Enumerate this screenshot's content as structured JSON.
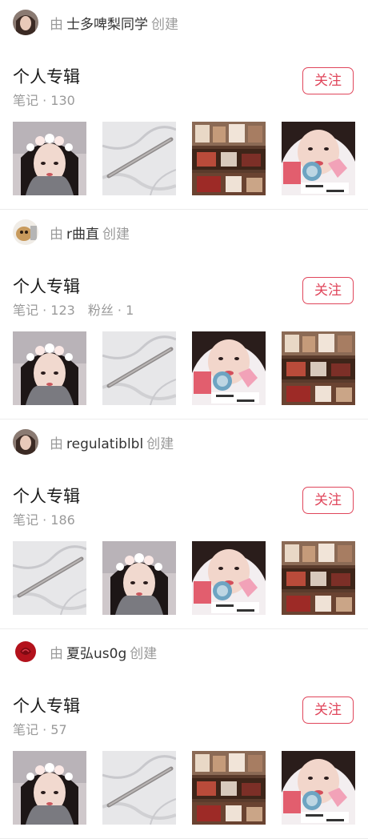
{
  "albums": [
    {
      "creator_prefix": "由",
      "creator_name": "士多啤梨同学",
      "creator_suffix": "创建",
      "avatar": "avatar-photo-girl",
      "title": "个人专辑",
      "notes_label": "笔记 · 130",
      "fans_label": "",
      "follow_label": "关注",
      "thumbnails": [
        "selfie-flower-crown",
        "eyebrow-pencil-marble",
        "cosmetics-shelf",
        "selfie-lip-tint"
      ]
    },
    {
      "creator_prefix": "由",
      "creator_name": "r曲直",
      "creator_suffix": "创建",
      "avatar": "avatar-photo-dog",
      "title": "个人专辑",
      "notes_label": "笔记 · 123",
      "fans_label": "粉丝 · 1",
      "follow_label": "关注",
      "thumbnails": [
        "selfie-flower-crown",
        "eyebrow-pencil-marble",
        "selfie-lip-tint",
        "cosmetics-shelf"
      ]
    },
    {
      "creator_prefix": "由",
      "creator_name": "regulatiblbl",
      "creator_suffix": "创建",
      "avatar": "avatar-photo-girl",
      "title": "个人专辑",
      "notes_label": "笔记 · 186",
      "fans_label": "",
      "follow_label": "关注",
      "thumbnails": [
        "eyebrow-pencil-marble",
        "selfie-flower-crown",
        "selfie-lip-tint",
        "cosmetics-shelf"
      ]
    },
    {
      "creator_prefix": "由",
      "creator_name": "夏弘us0g",
      "creator_suffix": "创建",
      "avatar": "avatar-red-rose",
      "title": "个人专辑",
      "notes_label": "笔记 · 57",
      "fans_label": "",
      "follow_label": "关注",
      "thumbnails": [
        "selfie-flower-crown",
        "eyebrow-pencil-marble",
        "cosmetics-shelf",
        "selfie-lip-tint"
      ]
    }
  ],
  "colors": {
    "accent": "#e0465b",
    "muted_text": "#9a9a9a",
    "divider": "#ececec"
  }
}
